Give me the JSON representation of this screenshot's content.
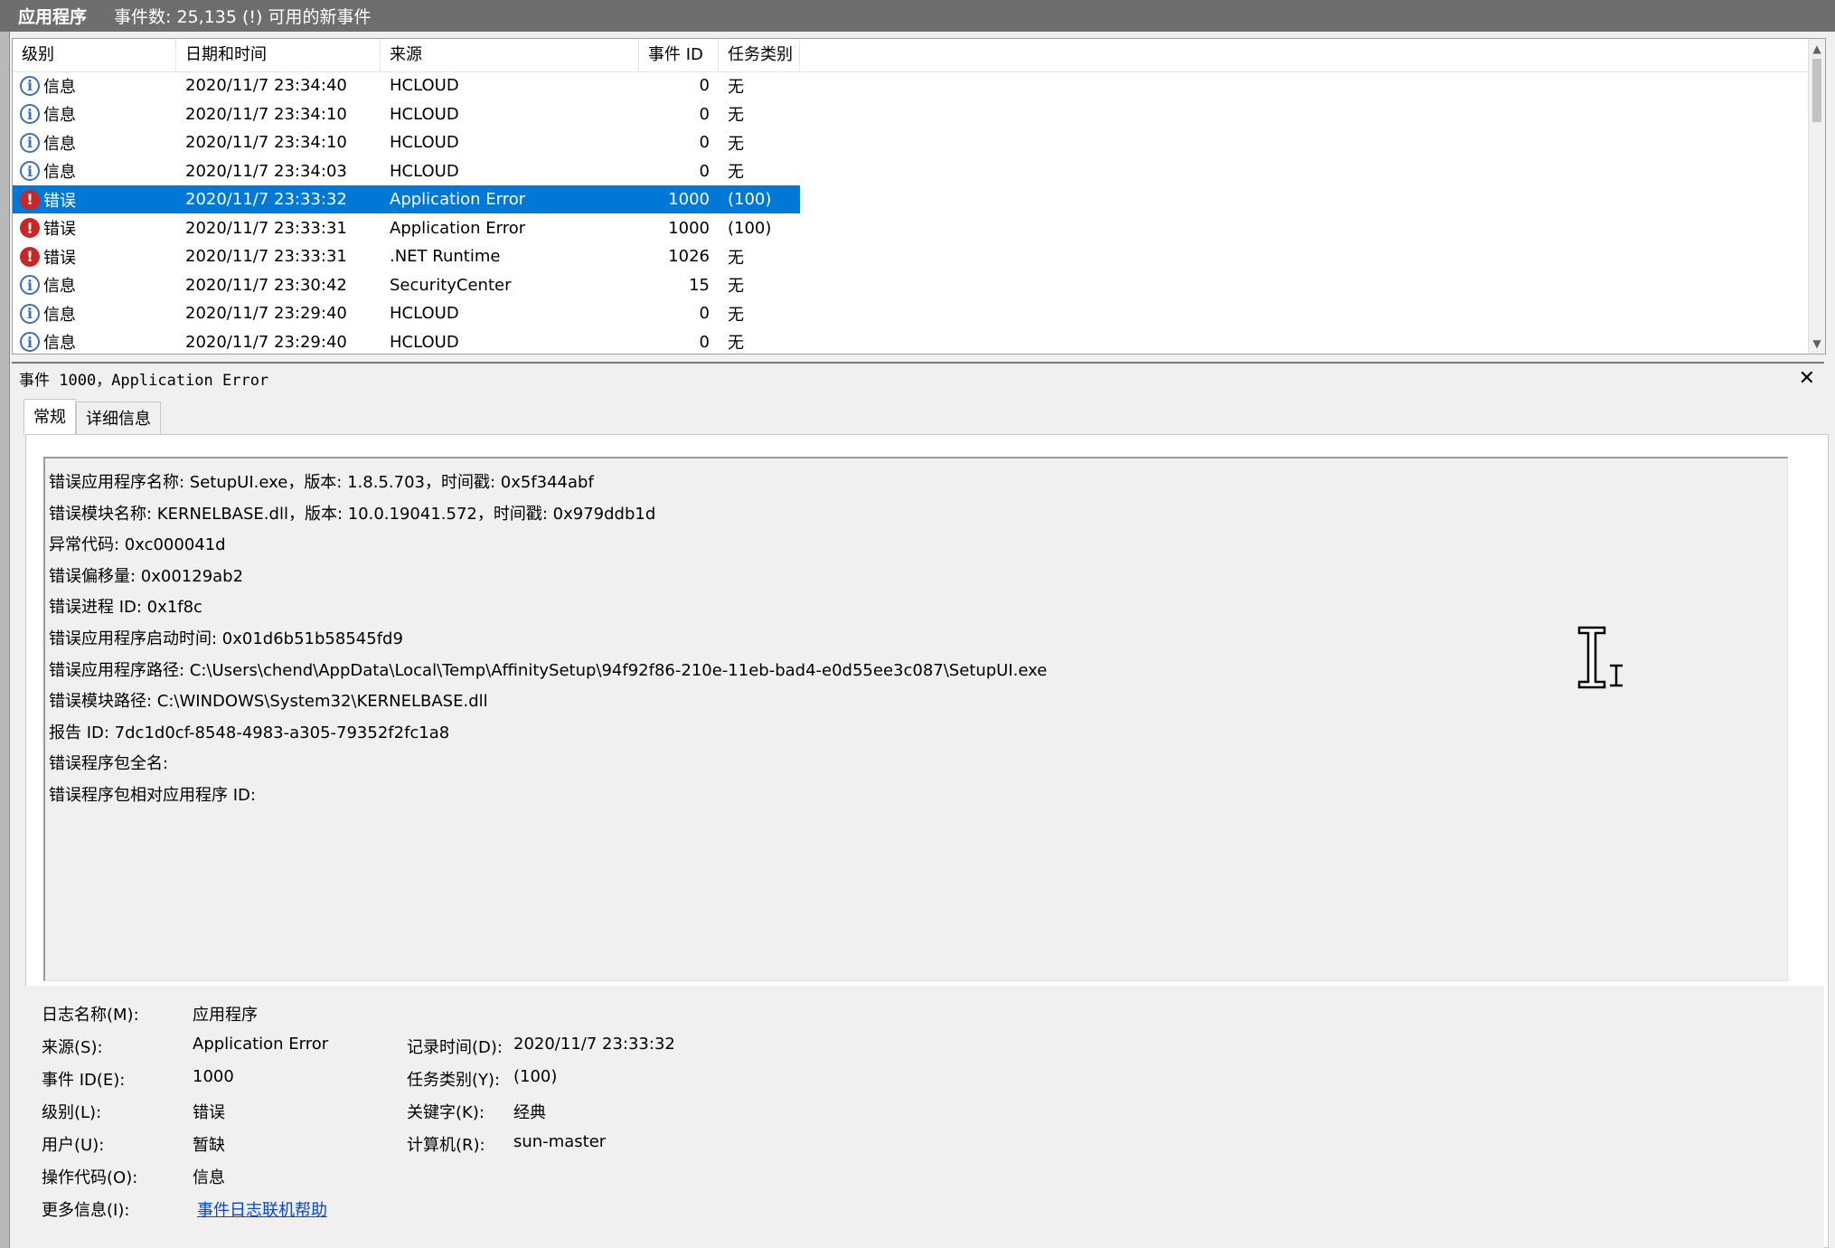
{
  "title": {
    "log_name": "应用程序",
    "count_text": "事件数: 25,135 (!) 可用的新事件"
  },
  "table": {
    "columns": [
      "级别",
      "日期和时间",
      "来源",
      "事件 ID",
      "任务类别"
    ],
    "rows": [
      {
        "icon": "info-icon",
        "level": "信息",
        "datetime": "2020/11/7 23:34:40",
        "source": "HCLOUD",
        "event_id": "0",
        "task": "无",
        "selected": false
      },
      {
        "icon": "info-icon",
        "level": "信息",
        "datetime": "2020/11/7 23:34:10",
        "source": "HCLOUD",
        "event_id": "0",
        "task": "无",
        "selected": false
      },
      {
        "icon": "info-icon",
        "level": "信息",
        "datetime": "2020/11/7 23:34:10",
        "source": "HCLOUD",
        "event_id": "0",
        "task": "无",
        "selected": false
      },
      {
        "icon": "info-icon",
        "level": "信息",
        "datetime": "2020/11/7 23:34:03",
        "source": "HCLOUD",
        "event_id": "0",
        "task": "无",
        "selected": false
      },
      {
        "icon": "error-icon",
        "level": "错误",
        "datetime": "2020/11/7 23:33:32",
        "source": "Application Error",
        "event_id": "1000",
        "task": "(100)",
        "selected": true
      },
      {
        "icon": "error-icon",
        "level": "错误",
        "datetime": "2020/11/7 23:33:31",
        "source": "Application Error",
        "event_id": "1000",
        "task": "(100)",
        "selected": false
      },
      {
        "icon": "error-icon",
        "level": "错误",
        "datetime": "2020/11/7 23:33:31",
        "source": ".NET Runtime",
        "event_id": "1026",
        "task": "无",
        "selected": false
      },
      {
        "icon": "info-icon",
        "level": "信息",
        "datetime": "2020/11/7 23:30:42",
        "source": "SecurityCenter",
        "event_id": "15",
        "task": "无",
        "selected": false
      },
      {
        "icon": "info-icon",
        "level": "信息",
        "datetime": "2020/11/7 23:29:40",
        "source": "HCLOUD",
        "event_id": "0",
        "task": "无",
        "selected": false
      },
      {
        "icon": "info-icon",
        "level": "信息",
        "datetime": "2020/11/7 23:29:40",
        "source": "HCLOUD",
        "event_id": "0",
        "task": "无",
        "selected": false
      }
    ]
  },
  "detail": {
    "header": "事件 1000，Application Error",
    "close": "✕",
    "tabs": [
      "常规",
      "详细信息"
    ],
    "description_lines": [
      "错误应用程序名称: SetupUI.exe，版本: 1.8.5.703，时间戳: 0x5f344abf",
      "错误模块名称: KERNELBASE.dll，版本: 10.0.19041.572，时间戳: 0x979ddb1d",
      "异常代码: 0xc000041d",
      "错误偏移量: 0x00129ab2",
      "错误进程 ID: 0x1f8c",
      "错误应用程序启动时间: 0x01d6b51b58545fd9",
      "错误应用程序路径: C:\\Users\\chend\\AppData\\Local\\Temp\\AffinitySetup\\94f92f86-210e-11eb-bad4-e0d55ee3c087\\SetupUI.exe",
      "错误模块路径: C:\\WINDOWS\\System32\\KERNELBASE.dll",
      "报告 ID: 7dc1d0cf-8548-4983-a305-79352f2fc1a8",
      "错误程序包全名:",
      "错误程序包相对应用程序 ID:"
    ],
    "props": {
      "log_name_label": "日志名称(M):",
      "log_name": "应用程序",
      "source_label": "来源(S):",
      "source": "Application Error",
      "logged_label": "记录时间(D):",
      "logged": "2020/11/7 23:33:32",
      "event_id_label": "事件 ID(E):",
      "event_id": "1000",
      "task_label": "任务类别(Y):",
      "task": "(100)",
      "level_label": "级别(L):",
      "level": "错误",
      "keywords_label": "关键字(K):",
      "keywords": "经典",
      "user_label": "用户(U):",
      "user": "暂缺",
      "computer_label": "计算机(R):",
      "computer": "sun-master",
      "opcode_label": "操作代码(O):",
      "opcode": "信息",
      "more_info_label": "更多信息(I):",
      "more_info_link": "事件日志联机帮助"
    }
  },
  "colors": {
    "selection": "#0078d7",
    "error": "#c62828",
    "info": "#3b6fb6",
    "link": "#0645d8"
  }
}
